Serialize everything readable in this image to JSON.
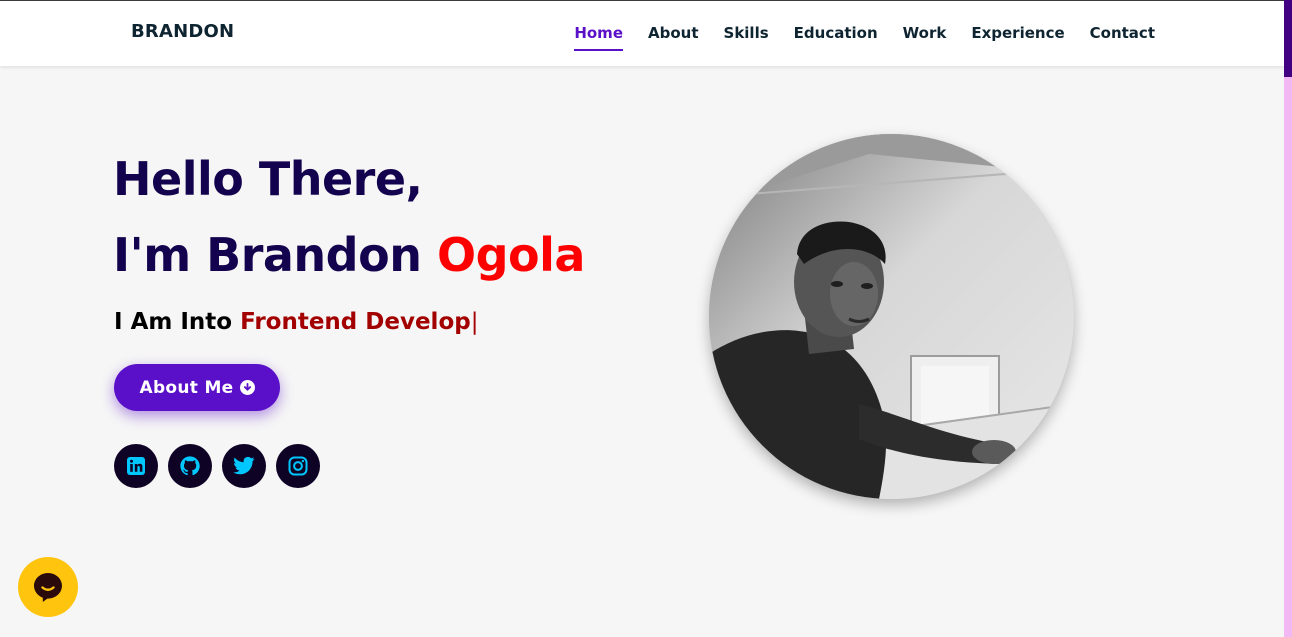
{
  "nav": {
    "brand": "BRANDON",
    "links": [
      {
        "label": "Home",
        "active": true
      },
      {
        "label": "About"
      },
      {
        "label": "Skills"
      },
      {
        "label": "Education"
      },
      {
        "label": "Work"
      },
      {
        "label": "Experience"
      },
      {
        "label": "Contact"
      }
    ]
  },
  "hero": {
    "line1": "Hello There,",
    "line2_prefix": "I'm Brandon ",
    "line2_accent": "Ogola",
    "typing_prefix": "I Am Into ",
    "typing_value": "Frontend Develop",
    "typing_cursor": "|",
    "about_button": "About Me",
    "about_icon": "arrow-circle-down-icon"
  },
  "socials": [
    {
      "name": "linkedin",
      "icon": "linkedin-icon"
    },
    {
      "name": "github",
      "icon": "github-icon"
    },
    {
      "name": "twitter",
      "icon": "twitter-icon"
    },
    {
      "name": "instagram",
      "icon": "instagram-icon"
    }
  ],
  "profile": {
    "image": "profile-photo"
  },
  "chat": {
    "icon": "chat-bubble-icon"
  },
  "colors": {
    "accent": "#5a0fc8",
    "heading": "#13024d",
    "highlight_red": "#ff0000",
    "typed_text": "#a30000",
    "social_bg": "#0e0225",
    "social_icon": "#00c8ff",
    "chat": "#ffc50e",
    "scroll_track": "#f1b8f3",
    "scroll_thumb": "#420083"
  }
}
